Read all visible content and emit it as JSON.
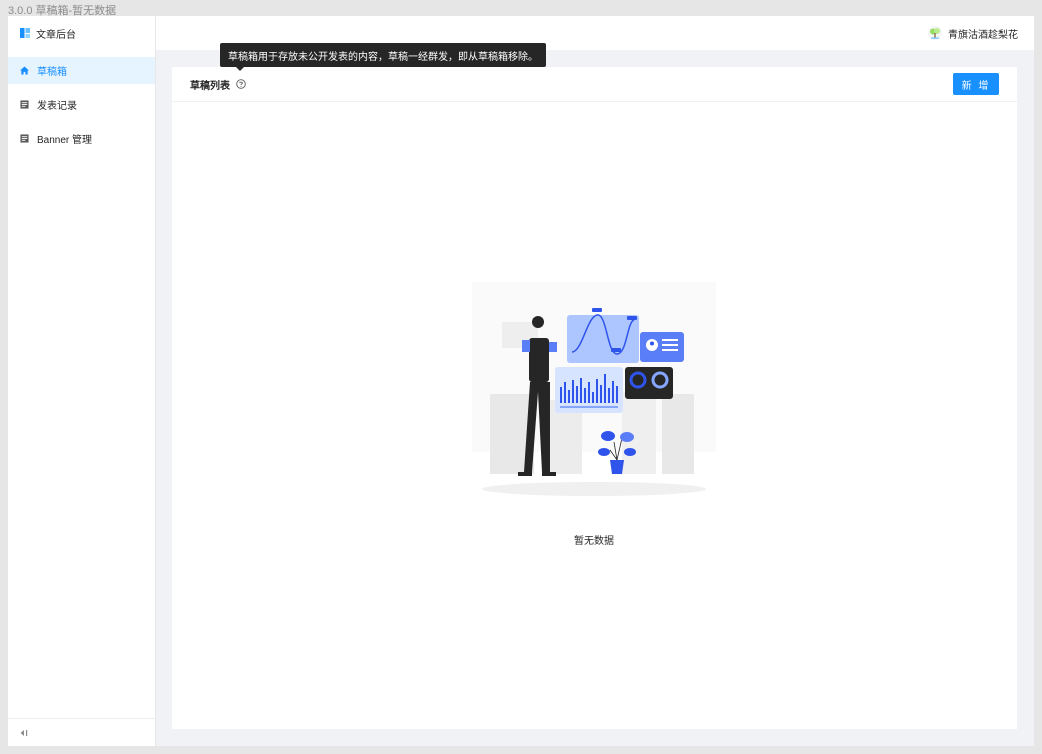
{
  "window": {
    "title": "3.0.0 草稿箱-暂无数据"
  },
  "sidebar": {
    "brand": {
      "label": "文章后台",
      "icon": "article-logo-icon"
    },
    "items": [
      {
        "label": "草稿箱",
        "icon": "home-icon",
        "active": true
      },
      {
        "label": "发表记录",
        "icon": "document-icon",
        "active": false
      },
      {
        "label": "Banner 管理",
        "icon": "document-icon",
        "active": false
      }
    ],
    "collapse_icon": "collapse-sidebar-icon"
  },
  "header": {
    "username": "青旗沽酒趁梨花",
    "avatar_icon": "tree-avatar-icon"
  },
  "card": {
    "title": "草稿列表",
    "help_icon": "question-circle-icon",
    "new_button": "新 增"
  },
  "tooltip": {
    "text": "草稿箱用于存放未公开发表的内容，草稿一经群发，即从草稿箱移除。"
  },
  "empty": {
    "text": "暂无数据",
    "illustration": "empty-data-illustration"
  },
  "colors": {
    "primary": "#1890ff",
    "active_bg": "#e6f4ff",
    "tooltip_bg": "#262626",
    "page_bg": "#f0f2f5"
  }
}
